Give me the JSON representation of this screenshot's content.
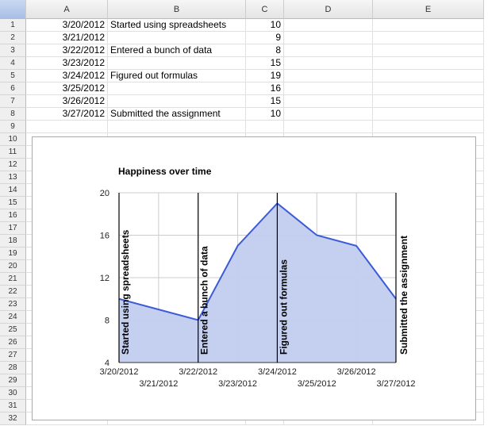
{
  "sheet": {
    "columns": [
      "A",
      "B",
      "C",
      "D",
      "E"
    ],
    "row_count": 32,
    "rows": [
      {
        "date": "3/20/2012",
        "note": "Started using spreadsheets",
        "value": "10"
      },
      {
        "date": "3/21/2012",
        "note": "",
        "value": "9"
      },
      {
        "date": "3/22/2012",
        "note": "Entered a bunch of data",
        "value": "8"
      },
      {
        "date": "3/23/2012",
        "note": "",
        "value": "15"
      },
      {
        "date": "3/24/2012",
        "note": "Figured out formulas",
        "value": "19"
      },
      {
        "date": "3/25/2012",
        "note": "",
        "value": "16"
      },
      {
        "date": "3/26/2012",
        "note": "",
        "value": "15"
      },
      {
        "date": "3/27/2012",
        "note": "Submitted the assignment",
        "value": "10"
      }
    ]
  },
  "chart_data": {
    "type": "area",
    "title": "Happiness over time",
    "x": [
      "3/20/2012",
      "3/21/2012",
      "3/22/2012",
      "3/23/2012",
      "3/24/2012",
      "3/25/2012",
      "3/26/2012",
      "3/27/2012"
    ],
    "values": [
      10,
      9,
      8,
      15,
      19,
      16,
      15,
      10
    ],
    "annotations": [
      {
        "index": 0,
        "text": "Started using spreadsheets"
      },
      {
        "index": 2,
        "text": "Entered a bunch of data"
      },
      {
        "index": 4,
        "text": "Figured out formulas"
      },
      {
        "index": 7,
        "text": "Submitted the assignment"
      }
    ],
    "ylim": [
      4,
      20
    ],
    "yticks": [
      4,
      8,
      12,
      16,
      20
    ],
    "grid": true,
    "colors": {
      "line": "#3c5bd6",
      "fill": "#c2cdef"
    }
  }
}
